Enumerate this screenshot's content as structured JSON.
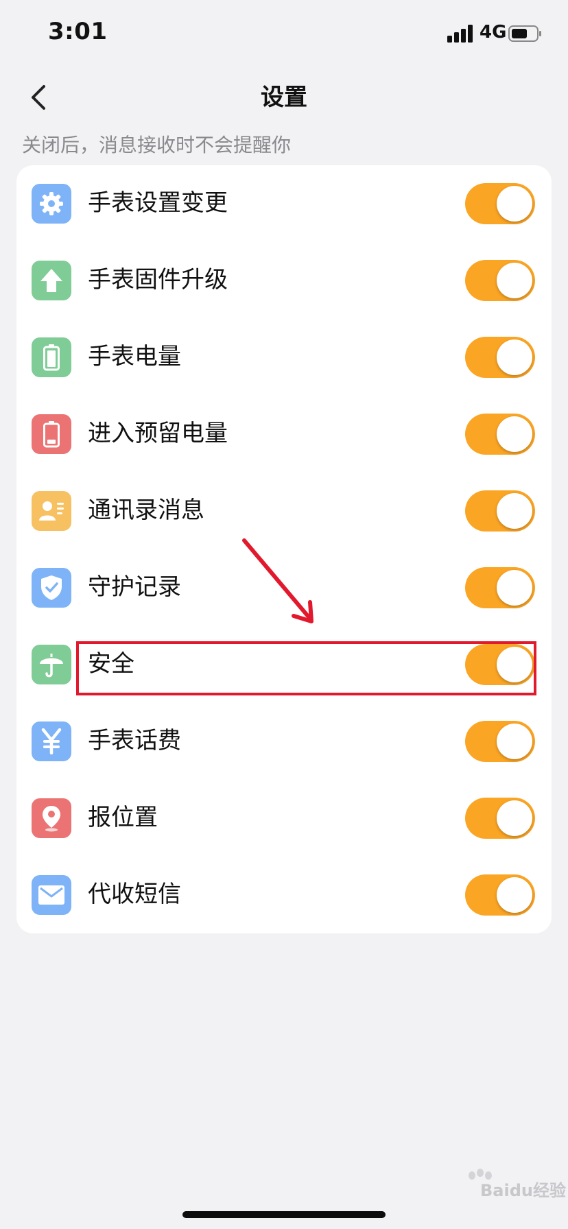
{
  "status_bar": {
    "time": "3:01",
    "network": "4G"
  },
  "nav": {
    "title": "设置"
  },
  "hint": "关闭后，消息接收时不会提醒你",
  "items": [
    {
      "label": "手表设置变更",
      "icon": "gear-icon",
      "icon_color": "#7eb3f7",
      "enabled": true
    },
    {
      "label": "手表固件升级",
      "icon": "arrow-up-icon",
      "icon_color": "#80cc96",
      "enabled": true
    },
    {
      "label": "手表电量",
      "icon": "battery-full-icon",
      "icon_color": "#80cc96",
      "enabled": true
    },
    {
      "label": "进入预留电量",
      "icon": "battery-low-icon",
      "icon_color": "#eb7373",
      "enabled": true
    },
    {
      "label": "通讯录消息",
      "icon": "contact-card-icon",
      "icon_color": "#f7c060",
      "enabled": true
    },
    {
      "label": "守护记录",
      "icon": "shield-check-icon",
      "icon_color": "#7eb3f7",
      "enabled": true
    },
    {
      "label": "安全",
      "icon": "umbrella-icon",
      "icon_color": "#80cc96",
      "enabled": true
    },
    {
      "label": "手表话费",
      "icon": "yen-icon",
      "icon_color": "#7eb3f7",
      "enabled": true
    },
    {
      "label": "报位置",
      "icon": "location-pin-icon",
      "icon_color": "#eb7373",
      "enabled": true
    },
    {
      "label": "代收短信",
      "icon": "envelope-icon",
      "icon_color": "#7eb3f7",
      "enabled": true
    }
  ],
  "colors": {
    "toggle_on": "#fba524",
    "annotation": "#e2192d",
    "background": "#f2f2f4"
  },
  "watermark": "Baidu经验"
}
